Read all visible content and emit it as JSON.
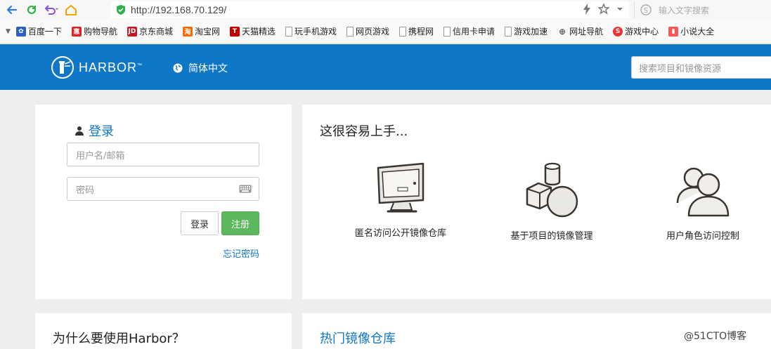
{
  "browser": {
    "url": "http://192.168.70.129/",
    "search_placeholder": "输入文字搜索",
    "bookmarks": [
      {
        "label": "百度一下",
        "color": "#2d5fc9"
      },
      {
        "label": "购物导航",
        "color": "#d22"
      },
      {
        "label": "京东商城",
        "color": "#c81623"
      },
      {
        "label": "淘宝网",
        "color": "#ff6a00"
      },
      {
        "label": "天猫精选",
        "color": "#c40000"
      },
      {
        "label": "玩手机游戏",
        "color": ""
      },
      {
        "label": "网页游戏",
        "color": ""
      },
      {
        "label": "携程网",
        "color": ""
      },
      {
        "label": "信用卡申请",
        "color": ""
      },
      {
        "label": "游戏加速",
        "color": ""
      },
      {
        "label": "网址导航",
        "color": ""
      },
      {
        "label": "游戏中心",
        "color": "#e33"
      },
      {
        "label": "小说大全",
        "color": "#f55"
      }
    ]
  },
  "header": {
    "logo_text": "HARBOR",
    "logo_tm": "™",
    "language": "简体中文",
    "search_placeholder": "搜索项目和镜像资源",
    "accent": "#0f77c8"
  },
  "login": {
    "title": "登录",
    "username_placeholder": "用户名/邮箱",
    "password_placeholder": "密码",
    "login_button": "登录",
    "register_button": "注册",
    "forgot_link": "忘记密码"
  },
  "intro": {
    "title": "这很容易上手...",
    "features": [
      {
        "label": "匿名访问公开镜像仓库",
        "icon": "monitor-icon"
      },
      {
        "label": "基于项目的镜像管理",
        "icon": "shapes-icon"
      },
      {
        "label": "用户角色访问控制",
        "icon": "users-icon"
      }
    ]
  },
  "why": {
    "title": "为什么要使用Harbor？"
  },
  "hot": {
    "title": "热门镜像仓库"
  },
  "watermark": "@51CTO博客"
}
